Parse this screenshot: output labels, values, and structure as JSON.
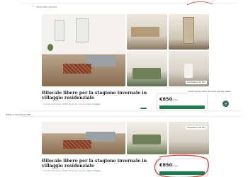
{
  "top": {
    "back_link": "Torna alle ricerche",
    "title": "Bilocale libero per la stagione invernale in villaggio residenziale",
    "address": "Via Cardinal Ferrari, 20045 Santo San Giovanni",
    "map_link": "Apri in mappa",
    "all_photos_label": "Visualizza le 18 foto",
    "price": "€850",
    "price_unit": "/mese",
    "tooltip": "Lorem ipsum dolor sit amet, sed per asseri",
    "chat_icon": "chat-icon"
  },
  "url_note": "HTML in Use Hiring URL",
  "bottom": {
    "title": "Bilocale libero per la stagione invernale in villaggio residenziale",
    "address": "Via Cardinal Ferrari, 20045 Santo San Giovanni",
    "map_link": "Apri in mappa",
    "all_photos_label": "Visualizza le 18 foto",
    "price": "€850",
    "price_unit": "/mese"
  },
  "colors": {
    "accent": "#1d7a4f",
    "annotation_red": "#d9382e",
    "chat_button": "#3a6b62"
  }
}
